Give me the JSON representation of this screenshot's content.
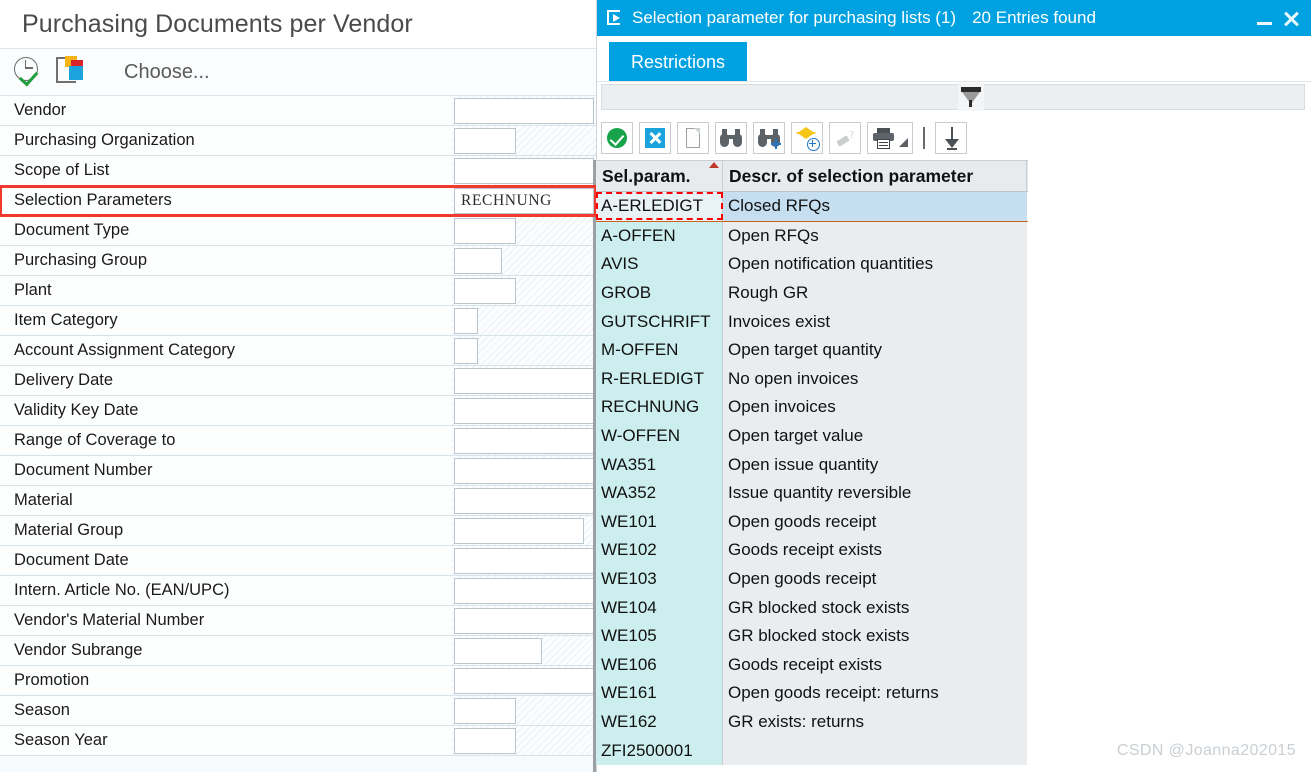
{
  "left": {
    "window_title": "Purchasing Documents per Vendor",
    "toolbar": {
      "execute_icon": "clock-check-icon",
      "multi_selection_icon": "multiple-selection-icon",
      "choose_label": "Choose..."
    },
    "fields": [
      {
        "label": "Vendor",
        "value": "",
        "input_width": 140
      },
      {
        "label": "Purchasing Organization",
        "value": "",
        "input_width": 62
      },
      {
        "label": "Scope of List",
        "value": "",
        "input_width": 140
      },
      {
        "label": "Selection Parameters",
        "value": "RECHNUNG",
        "input_width": 140,
        "highlighted": true
      },
      {
        "label": "Document Type",
        "value": "",
        "input_width": 62
      },
      {
        "label": "Purchasing Group",
        "value": "",
        "input_width": 48
      },
      {
        "label": "Plant",
        "value": "",
        "input_width": 62
      },
      {
        "label": "Item Category",
        "value": "",
        "input_width": 24
      },
      {
        "label": "Account Assignment Category",
        "value": "",
        "input_width": 24
      },
      {
        "label": "Delivery Date",
        "value": "",
        "input_width": 140
      },
      {
        "label": "Validity Key Date",
        "value": "",
        "input_width": 140
      },
      {
        "label": "Range of Coverage to",
        "value": "",
        "input_width": 140
      },
      {
        "label": "Document Number",
        "value": "",
        "input_width": 140
      },
      {
        "label": "Material",
        "value": "",
        "input_width": 140
      },
      {
        "label": "Material Group",
        "value": "",
        "input_width": 130
      },
      {
        "label": "Document Date",
        "value": "",
        "input_width": 140
      },
      {
        "label": "Intern. Article No. (EAN/UPC)",
        "value": "",
        "input_width": 140
      },
      {
        "label": "Vendor's Material Number",
        "value": "",
        "input_width": 140
      },
      {
        "label": "Vendor Subrange",
        "value": "",
        "input_width": 88
      },
      {
        "label": "Promotion",
        "value": "",
        "input_width": 140
      },
      {
        "label": "Season",
        "value": "",
        "input_width": 62
      },
      {
        "label": "Season Year",
        "value": "",
        "input_width": 62
      }
    ]
  },
  "right": {
    "titlebar": {
      "icon": "selection-list-icon",
      "title": "Selection parameter for purchasing lists (1)",
      "entries_found": "20 Entries found",
      "minimize_icon": "minimize-icon",
      "close_icon": "close-icon"
    },
    "tabs": [
      {
        "label": "Restrictions",
        "active": true
      }
    ],
    "filter_bar": {
      "funnel_icon": "filter-funnel-icon"
    },
    "toolbar": [
      {
        "name": "copy-button",
        "icon": "green-check-icon",
        "enabled": true
      },
      {
        "name": "cancel-button",
        "icon": "blue-x-icon",
        "enabled": true
      },
      {
        "name": "new-entry-button",
        "icon": "blank-page-icon",
        "enabled": true
      },
      {
        "name": "find-button",
        "icon": "binoculars-icon",
        "enabled": true
      },
      {
        "name": "find-next-button",
        "icon": "binoculars-plus-icon",
        "enabled": true
      },
      {
        "name": "create-favorite-button",
        "icon": "star-plus-icon",
        "enabled": true
      },
      {
        "name": "personal-value-button",
        "icon": "pencil-help-icon",
        "enabled": false
      },
      {
        "name": "print-button",
        "icon": "printer-icon",
        "enabled": true
      },
      {
        "name": "separator",
        "icon": "separator-icon",
        "enabled": false
      },
      {
        "name": "filter-button",
        "icon": "funnel-down-icon",
        "enabled": true
      }
    ],
    "table": {
      "columns": [
        "Sel.param.",
        "Descr. of selection parameter"
      ],
      "sort_indicator_column": 0,
      "selected_row_index": 0,
      "rows": [
        {
          "param": "A-ERLEDIGT",
          "descr": "Closed RFQs"
        },
        {
          "param": "A-OFFEN",
          "descr": "Open RFQs"
        },
        {
          "param": "AVIS",
          "descr": "Open notification quantities"
        },
        {
          "param": "GROB",
          "descr": "Rough GR"
        },
        {
          "param": "GUTSCHRIFT",
          "descr": "Invoices exist"
        },
        {
          "param": "M-OFFEN",
          "descr": "Open target quantity"
        },
        {
          "param": "R-ERLEDIGT",
          "descr": "No open invoices"
        },
        {
          "param": "RECHNUNG",
          "descr": "Open invoices"
        },
        {
          "param": "W-OFFEN",
          "descr": "Open target value"
        },
        {
          "param": "WA351",
          "descr": "Open issue quantity"
        },
        {
          "param": "WA352",
          "descr": "Issue quantity reversible"
        },
        {
          "param": "WE101",
          "descr": "Open goods receipt"
        },
        {
          "param": "WE102",
          "descr": "Goods receipt exists"
        },
        {
          "param": "WE103",
          "descr": "Open goods receipt"
        },
        {
          "param": "WE104",
          "descr": "GR blocked stock exists"
        },
        {
          "param": "WE105",
          "descr": "GR blocked stock exists"
        },
        {
          "param": "WE106",
          "descr": "Goods receipt exists"
        },
        {
          "param": "WE161",
          "descr": "Open goods receipt: returns"
        },
        {
          "param": "WE162",
          "descr": "GR exists: returns"
        },
        {
          "param": "ZFI2500001",
          "descr": ""
        }
      ]
    },
    "watermark": "CSDN @Joanna202015"
  },
  "colors": {
    "accent_blue": "#00a1e0",
    "highlight_red": "#f03a30",
    "row_key_cyan": "#cdeeee",
    "row_descr_gray": "#e9edef",
    "selected_blue": "#c5dff0",
    "selected_border": "#c8651a"
  }
}
